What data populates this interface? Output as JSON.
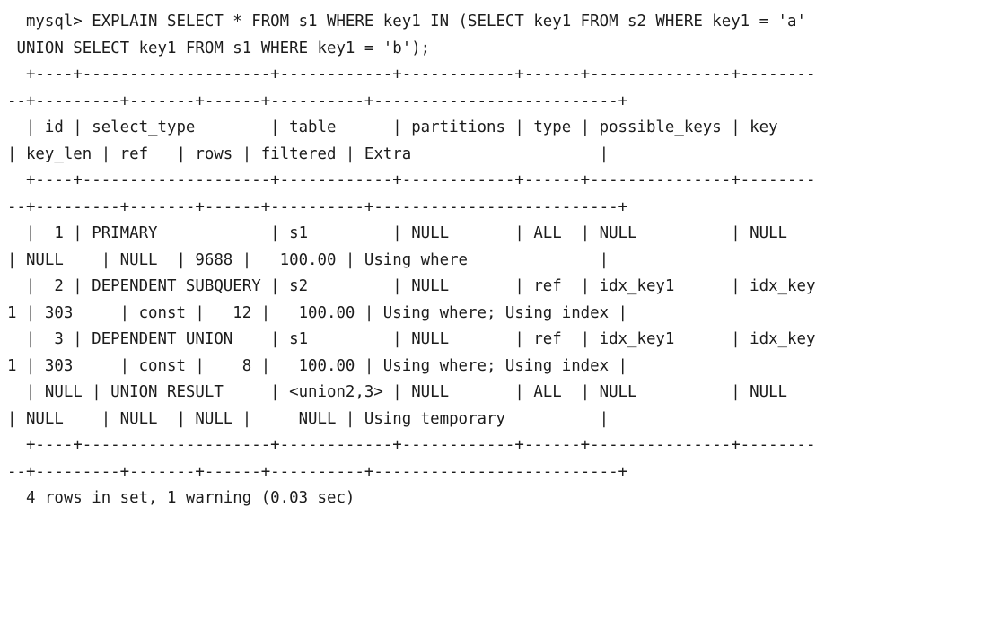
{
  "terminal": {
    "kind": "mysql-client-output",
    "background_color": "#ffffff",
    "text_color": "#1c1c1c",
    "prompt": "mysql>",
    "statement": "EXPLAIN SELECT * FROM s1 WHERE key1 IN (SELECT key1 FROM s2 WHERE key1 = 'a' UNION SELECT key1 FROM s1 WHERE key1 = 'b');",
    "columns": [
      "id",
      "select_type",
      "table",
      "partitions",
      "type",
      "possible_keys",
      "key",
      "key_len",
      "ref",
      "rows",
      "filtered",
      "Extra"
    ],
    "rows": [
      {
        "id": "1",
        "select_type": "PRIMARY",
        "table": "s1",
        "partitions": "NULL",
        "type": "ALL",
        "possible_keys": "NULL",
        "key": "NULL",
        "key_len": "NULL",
        "ref": "NULL",
        "rows": "9688",
        "filtered": "100.00",
        "Extra": "Using where"
      },
      {
        "id": "2",
        "select_type": "DEPENDENT SUBQUERY",
        "table": "s2",
        "partitions": "NULL",
        "type": "ref",
        "possible_keys": "idx_key1",
        "key": "idx_key1",
        "key_len": "303",
        "ref": "const",
        "rows": "12",
        "filtered": "100.00",
        "Extra": "Using where; Using index"
      },
      {
        "id": "3",
        "select_type": "DEPENDENT UNION",
        "table": "s1",
        "partitions": "NULL",
        "type": "ref",
        "possible_keys": "idx_key1",
        "key": "idx_key1",
        "key_len": "303",
        "ref": "const",
        "rows": "8",
        "filtered": "100.00",
        "Extra": "Using where; Using index"
      },
      {
        "id": "NULL",
        "select_type": "UNION RESULT",
        "table": "<union2,3>",
        "partitions": "NULL",
        "type": "ALL",
        "possible_keys": "NULL",
        "key": "NULL",
        "key_len": "NULL",
        "ref": "NULL",
        "rows": "NULL",
        "filtered": "NULL",
        "Extra": "Using temporary"
      }
    ],
    "status": "4 rows in set, 1 warning (0.03 sec)",
    "lines": [
      "  mysql> EXPLAIN SELECT * FROM s1 WHERE key1 IN (SELECT key1 FROM s2 WHERE key1 = 'a'",
      " UNION SELECT key1 FROM s1 WHERE key1 = 'b');",
      "  +----+--------------------+------------+------------+------+---------------+--------",
      "--+---------+-------+------+----------+--------------------------+",
      "  | id | select_type        | table      | partitions | type | possible_keys | key",
      "| key_len | ref   | rows | filtered | Extra                    |",
      "  +----+--------------------+------------+------------+------+---------------+--------",
      "--+---------+-------+------+----------+--------------------------+",
      "  |  1 | PRIMARY            | s1         | NULL       | ALL  | NULL          | NULL",
      "| NULL    | NULL  | 9688 |   100.00 | Using where              |",
      "  |  2 | DEPENDENT SUBQUERY | s2         | NULL       | ref  | idx_key1      | idx_key",
      "1 | 303     | const |   12 |   100.00 | Using where; Using index |",
      "  |  3 | DEPENDENT UNION    | s1         | NULL       | ref  | idx_key1      | idx_key",
      "1 | 303     | const |    8 |   100.00 | Using where; Using index |",
      "  | NULL | UNION RESULT     | <union2,3> | NULL       | ALL  | NULL          | NULL",
      "| NULL    | NULL  | NULL |     NULL | Using temporary          |",
      "  +----+--------------------+------------+------------+------+---------------+--------",
      "--+---------+-------+------+----------+--------------------------+",
      "  4 rows in set, 1 warning (0.03 sec)"
    ]
  }
}
